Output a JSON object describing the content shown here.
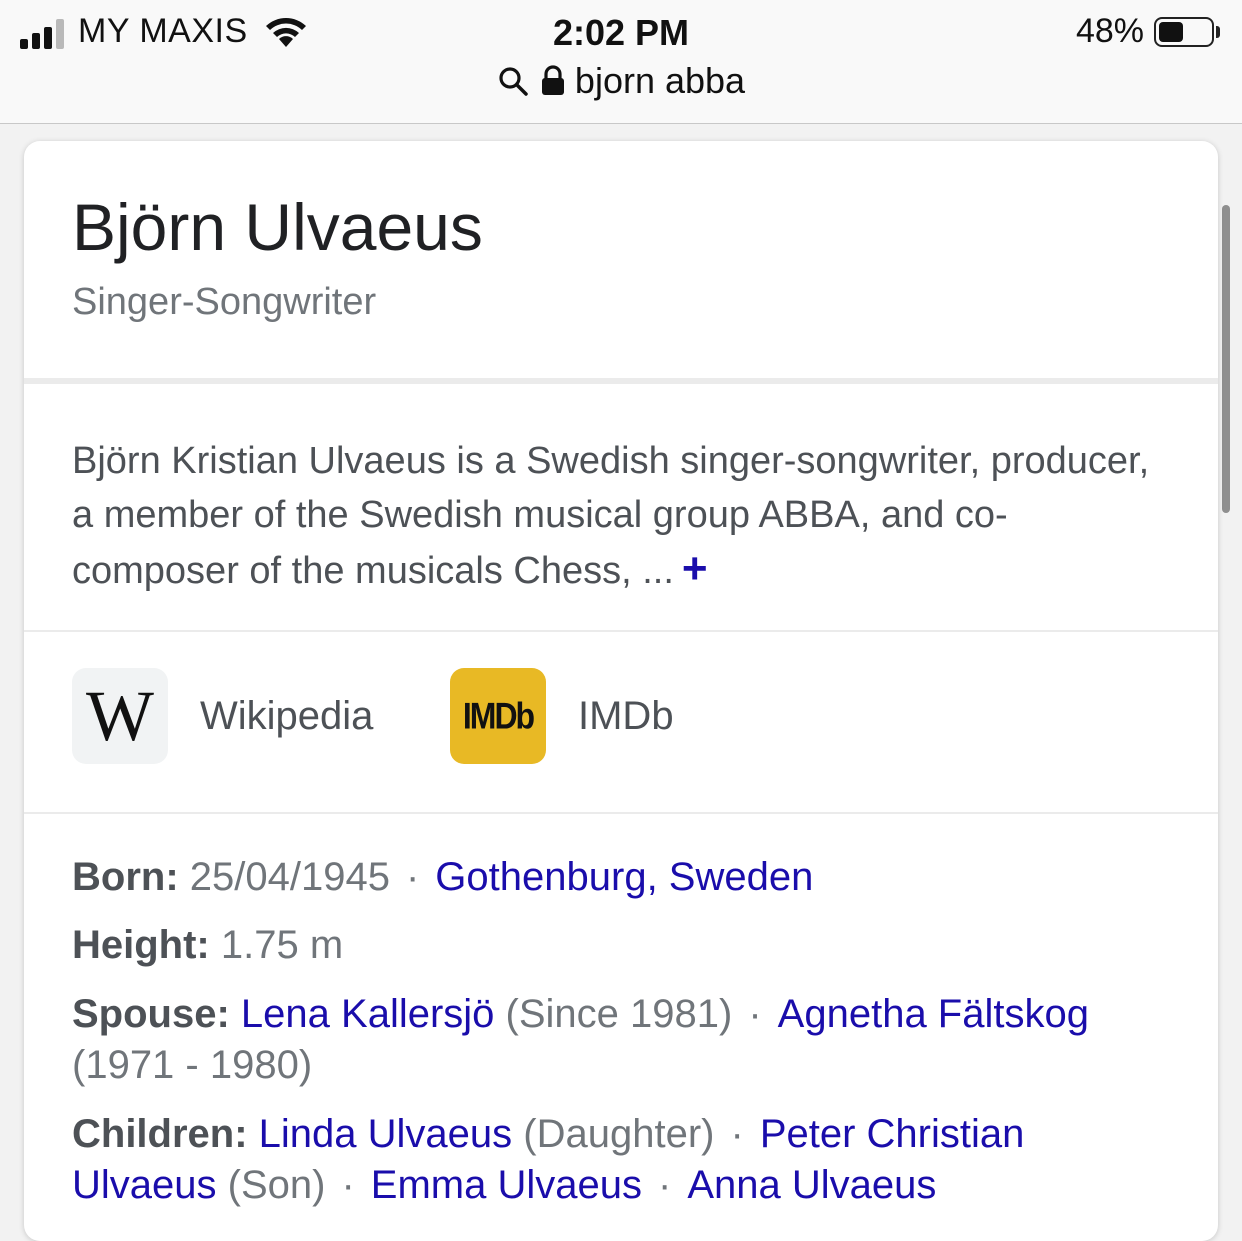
{
  "status_bar": {
    "carrier": "MY MAXIS",
    "time": "2:02 PM",
    "battery_percent": "48%",
    "battery_level": 0.48,
    "signal_bars": 3,
    "signal_total": 4
  },
  "url_bar": {
    "query": "bjorn abba"
  },
  "card": {
    "title": "Björn Ulvaeus",
    "subtitle": "Singer-Songwriter",
    "description": "Björn Kristian Ulvaeus is a Swedish singer-songwriter, producer, a member of the Swedish musical group ABBA, and co-composer of the musicals Chess, ...",
    "more": "+",
    "links": [
      {
        "logo": "W",
        "label": "Wikipedia"
      },
      {
        "logo": "IMDb",
        "label": "IMDb"
      }
    ],
    "facts": {
      "born": {
        "label": "Born:",
        "date": "25/04/1945",
        "place": "Gothenburg, Sweden"
      },
      "height": {
        "label": "Height:",
        "value": "1.75 m"
      },
      "spouse": {
        "label": "Spouse:",
        "items": [
          {
            "name": "Lena Kallersjö",
            "note": "(Since 1981)"
          },
          {
            "name": "Agnetha Fältskog",
            "note": "(1971 - 1980)"
          }
        ]
      },
      "children": {
        "label": "Children:",
        "items": [
          {
            "name": "Linda Ulvaeus",
            "note": "(Daughter)"
          },
          {
            "name": "Peter Christian Ulvaeus",
            "note": "(Son)"
          },
          {
            "name": "Emma Ulvaeus"
          },
          {
            "name": "Anna Ulvaeus"
          }
        ]
      },
      "separator": "·"
    }
  },
  "colors": {
    "link": "#1a0dab",
    "title": "#202124",
    "muted": "#70757a",
    "imdb_yellow": "#e8b925"
  }
}
